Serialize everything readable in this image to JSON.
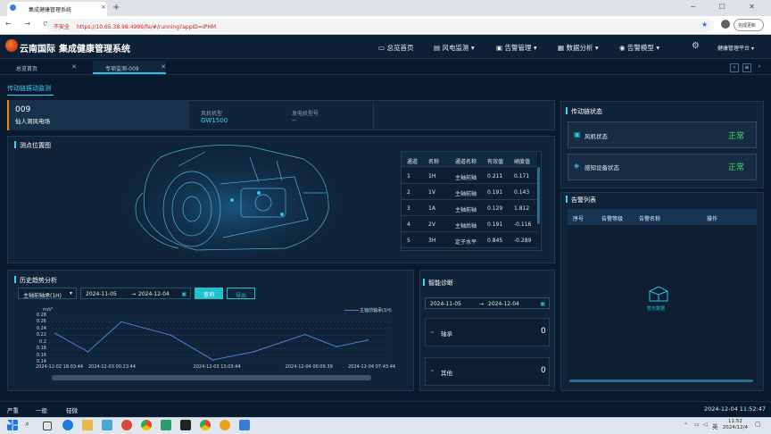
{
  "browser": {
    "tab_title": "集成健康管理系统",
    "tab_close": "×",
    "new_tab": "+",
    "window_controls": "─ ☐ ✕",
    "nav_icons": "← → ⟳",
    "insecure_label": "不安全",
    "url": "https://10.65.38.98:4999/fe/#/running?appID=IPHM",
    "update_button": "完成更新"
  },
  "header": {
    "brand": "云南国际",
    "title": "集成健康管理系统",
    "nav": [
      "总览首页",
      "风电监测",
      "告警管理",
      "数据分析",
      "告警模型"
    ],
    "platform": "健康管理平台"
  },
  "app_tabs": [
    "总览首页",
    "专项监测-009"
  ],
  "section_title": "传动链振动监测",
  "turbine": {
    "code": "009",
    "farm": "仙人洞风电场",
    "model_label": "风机机型",
    "model_value": "GW1500",
    "gen_label": "发电机型号",
    "gen_value": "--"
  },
  "measure_point": {
    "title": "测点位置图",
    "columns": [
      "通道",
      "名称",
      "通道名称",
      "有效值",
      "峭度值"
    ],
    "rows": [
      [
        "1",
        "1H",
        "主轴前轴",
        "0.211",
        "0.171"
      ],
      [
        "2",
        "1V",
        "主轴前轴",
        "0.191",
        "0.143"
      ],
      [
        "3",
        "1A",
        "主轴前轴",
        "0.129",
        "1.812"
      ],
      [
        "4",
        "2V",
        "主轴后轴",
        "0.191",
        "-0.116"
      ],
      [
        "5",
        "3H",
        "定子水平",
        "0.845",
        "-0.289"
      ]
    ]
  },
  "history": {
    "title": "历史趋势分析",
    "channel_select": "主轴前轴承(1H)",
    "date_start": "2024-11-05",
    "date_end": "2024-12-04",
    "arrow": "→",
    "query_button": "查询",
    "export_button": "导出",
    "unit": "m/s²"
  },
  "chart_data": {
    "type": "line",
    "title": "",
    "xlabel": "",
    "ylabel": "m/s²",
    "legend": [
      "主轴前轴承(1H)"
    ],
    "legend_position": "top-right",
    "ylim": [
      0.14,
      0.28
    ],
    "yticks": [
      "0.28",
      "0.26",
      "0.24",
      "0.22",
      "0.2",
      "0.18",
      "0.16",
      "0.14"
    ],
    "xticks": [
      "2024-12-02 18:03:44",
      "2024-12-03 00:23:44",
      "2024-12-03 13:03:44",
      "2024-12-04 00:09:39",
      "2024-12-04 07:43:44"
    ],
    "series": [
      {
        "name": "主轴前轴承(1H)",
        "x": [
          "2024-12-02 18:03:44",
          "2024-12-02 22:00:00",
          "2024-12-03 02:00:00",
          "2024-12-03 08:00:00",
          "2024-12-03 13:03:44",
          "2024-12-03 18:00:00",
          "2024-12-04 00:09:39",
          "2024-12-04 04:00:00",
          "2024-12-04 07:43:44"
        ],
        "values": [
          0.225,
          0.17,
          0.26,
          0.22,
          0.145,
          0.17,
          0.222,
          0.185,
          0.205
        ]
      }
    ],
    "grid": true
  },
  "diagnosis": {
    "title": "智能诊断",
    "date_start": "2024-11-05",
    "date_end": "2024-12-04",
    "arrow": "→",
    "items": [
      {
        "label": "轴承",
        "count": "0"
      },
      {
        "label": "其他",
        "count": "0"
      }
    ]
  },
  "drive_status": {
    "title": "传动链状态",
    "items": [
      {
        "label": "风机状态",
        "status": "正常"
      },
      {
        "label": "感知设备状态",
        "status": "正常"
      }
    ]
  },
  "alarm_list": {
    "title": "告警列表",
    "columns": [
      "序号",
      "告警等级",
      "告警名称",
      "操作"
    ],
    "empty": "暂无数据"
  },
  "footer": {
    "levels": [
      "严重",
      "一般",
      "轻微"
    ],
    "datetime": "2024-12-04 11:52:47"
  },
  "taskbar": {
    "time": "11:52",
    "date": "2024/12/4",
    "lang": "英"
  },
  "colors": {
    "accent": "#3fd2ff",
    "ok": "#3ce070",
    "orange": "#ff8a00",
    "line": "#4a82d8"
  }
}
